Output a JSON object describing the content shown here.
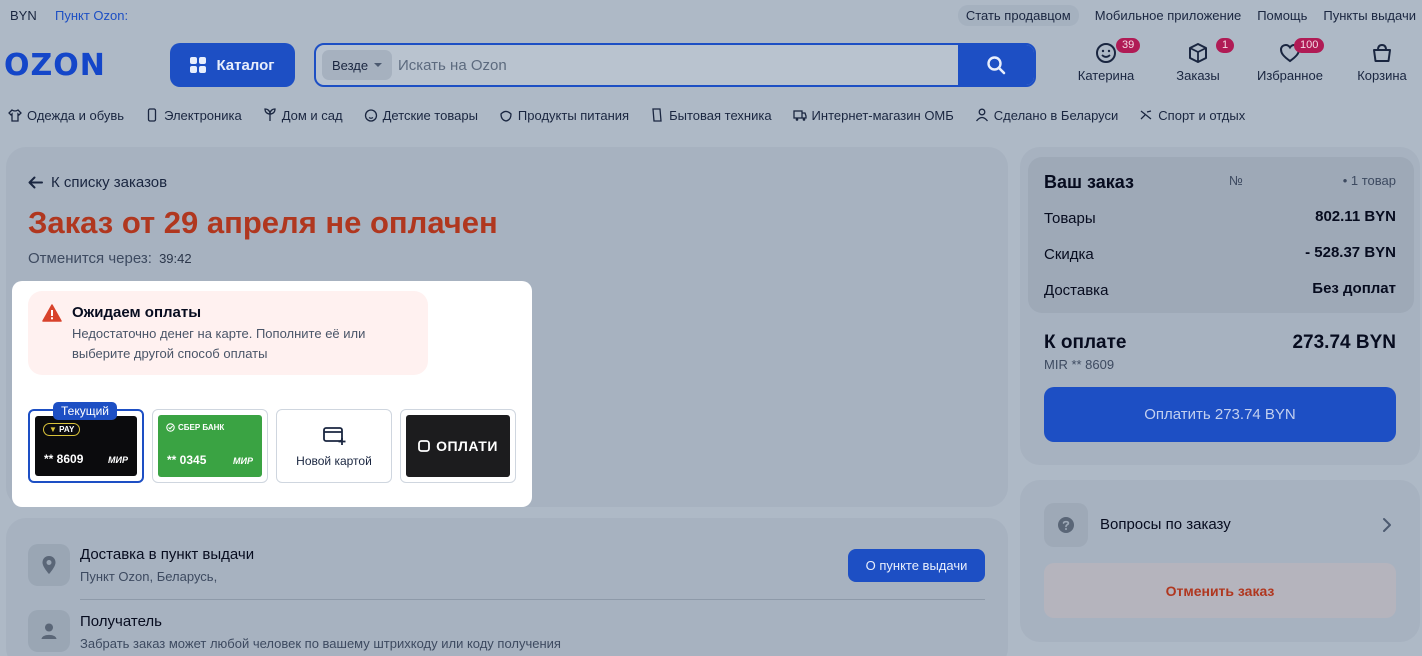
{
  "topbar": {
    "currency": "BYN",
    "location": "Пункт Ozon:",
    "links": [
      "Стать продавцом",
      "Мобильное приложение",
      "Помощь",
      "Пункты выдачи"
    ]
  },
  "header": {
    "logo": "OZON",
    "catalog_label": "Каталог",
    "search_scope": "Везде",
    "search_placeholder": "Искать на Ozon",
    "profile": {
      "label": "Катерина",
      "badge": "39"
    },
    "orders": {
      "label": "Заказы",
      "badge": "1"
    },
    "favorites": {
      "label": "Избранное",
      "badge": "100"
    },
    "cart": {
      "label": "Корзина"
    }
  },
  "categories": [
    {
      "label": "Одежда и обувь",
      "icon": "clothes-icon"
    },
    {
      "label": "Электроника",
      "icon": "phone-icon"
    },
    {
      "label": "Дом и сад",
      "icon": "plant-icon"
    },
    {
      "label": "Детские товары",
      "icon": "baby-icon"
    },
    {
      "label": "Продукты питания",
      "icon": "food-icon"
    },
    {
      "label": "Бытовая техника",
      "icon": "appliance-icon"
    },
    {
      "label": "Интернет-магазин ОМБ",
      "icon": "truck-icon"
    },
    {
      "label": "Сделано в Беларуси",
      "icon": "person-icon"
    },
    {
      "label": "Спорт и отдых",
      "icon": "sport-icon"
    }
  ],
  "order": {
    "back_label": "К списку заказов",
    "title": "Заказ от 29 апреля не оплачен",
    "cancel_in_label": "Отменится через:",
    "timer": "39:42"
  },
  "payment": {
    "alert_title": "Ожидаем оплаты",
    "alert_text": "Недостаточно денег на карте. Пополните её или выберите другой способ оплаты",
    "current_tag": "Текущий",
    "cards": [
      {
        "brand": "PAY",
        "number": "** 8609",
        "system": "МИР",
        "color": "#0b0b0d"
      },
      {
        "brand": "СБЕР БАНК",
        "number": "** 0345",
        "system": "МИР",
        "color": "#3aa343"
      },
      {
        "label": "Новой картой"
      },
      {
        "label": "ОПЛАТИ",
        "color": "#1c1c1e"
      }
    ]
  },
  "delivery": {
    "title": "Доставка в пункт выдачи",
    "subtitle": "Пункт Ozon, Беларусь,",
    "button": "О пункте выдачи"
  },
  "recipient": {
    "title": "Получатель",
    "subtitle": "Забрать заказ может любой человек по вашему штрихкоду или коду получения"
  },
  "summary": {
    "title": "Ваш заказ",
    "number_label": "№",
    "count": "• 1 товар",
    "rows": [
      {
        "label": "Товары",
        "value": "802.11 BYN"
      },
      {
        "label": "Скидка",
        "value": "- 528.37 BYN"
      },
      {
        "label": "Доставка",
        "value": "Без доплат"
      }
    ],
    "total_label": "К оплате",
    "total_value": "273.74 BYN",
    "total_card": "MIR ** 8609",
    "pay_button": "Оплатить 273.74 BYN",
    "questions_label": "Вопросы по заказу",
    "cancel_button": "Отменить заказ"
  },
  "colors": {
    "brand": "#1d4fc4",
    "alert_red": "#b0371f",
    "badge": "#b01b55"
  }
}
